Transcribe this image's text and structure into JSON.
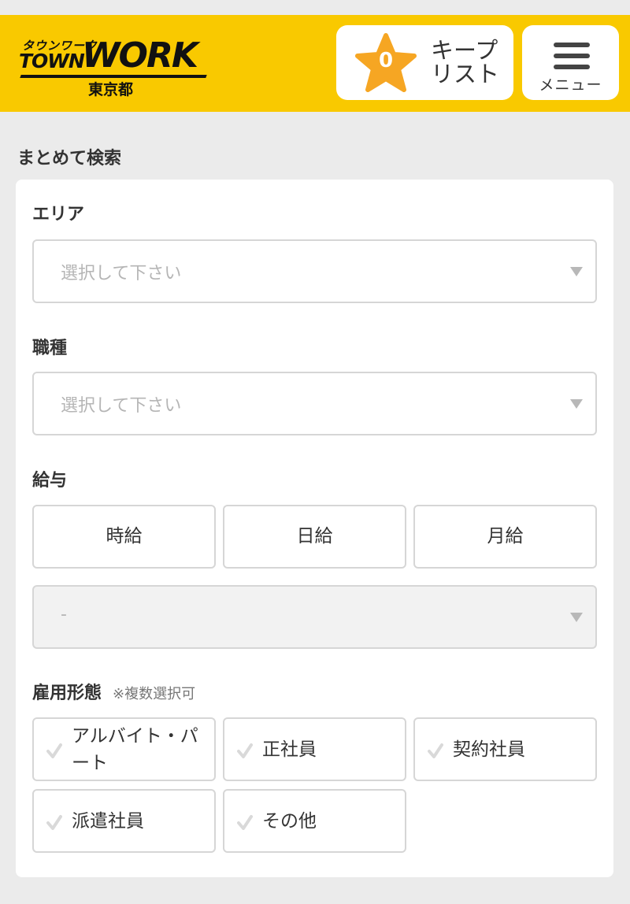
{
  "header": {
    "logo": {
      "kana": "タウンワーク",
      "town": "TOWN",
      "work": "WORK",
      "prefecture": "東京都"
    },
    "keep": {
      "count": "0",
      "label": "キープ リスト"
    },
    "menu": {
      "label": "メニュー"
    }
  },
  "search": {
    "title": "まとめて検索",
    "area": {
      "label": "エリア",
      "placeholder": "選択して下さい"
    },
    "job": {
      "label": "職種",
      "placeholder": "選択して下さい"
    },
    "salary": {
      "label": "給与",
      "types": [
        "時給",
        "日給",
        "月給"
      ],
      "amount_placeholder": "-"
    },
    "employment": {
      "label": "雇用形態",
      "note": "※複数選択可",
      "options": [
        "アルバイト・パート",
        "正社員",
        "契約社員",
        "派遣社員",
        "その他"
      ]
    }
  },
  "colors": {
    "header_bg": "#f9c900",
    "star": "#f6a623",
    "page_bg": "#ebebeb"
  },
  "icons": [
    "star-icon",
    "hamburger-icon",
    "caret-down-icon",
    "check-icon"
  ]
}
